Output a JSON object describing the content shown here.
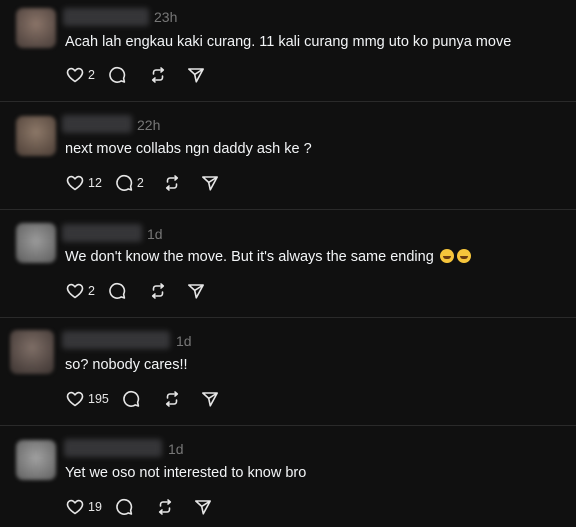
{
  "replies": [
    {
      "time": "23h",
      "text": "Acah lah engkau kaki curang. 11 kali curang mmg uto ko punya move",
      "likes": "2",
      "replies_count": ""
    },
    {
      "time": "22h",
      "text": "next move collabs ngn daddy ash ke ?",
      "likes": "12",
      "replies_count": "2"
    },
    {
      "time": "1d",
      "text": "We don't know the move. But it's always the same ending",
      "emojis": [
        "loudly-crying-face-emoji",
        "rolling-on-floor-laughing-emoji"
      ],
      "likes": "2",
      "replies_count": ""
    },
    {
      "time": "1d",
      "text": "so? nobody cares!!",
      "likes": "195",
      "replies_count": ""
    },
    {
      "time": "1d",
      "text": "Yet we oso not interested to know bro",
      "likes": "19",
      "replies_count": ""
    }
  ],
  "icons": {
    "like": "heart-icon",
    "reply": "comment-bubble-icon",
    "repost": "repost-icon",
    "share": "send-icon"
  },
  "colors": {
    "background": "#101010",
    "text": "#f3f5f7",
    "muted": "#777777",
    "divider": "#2a2a2a"
  }
}
